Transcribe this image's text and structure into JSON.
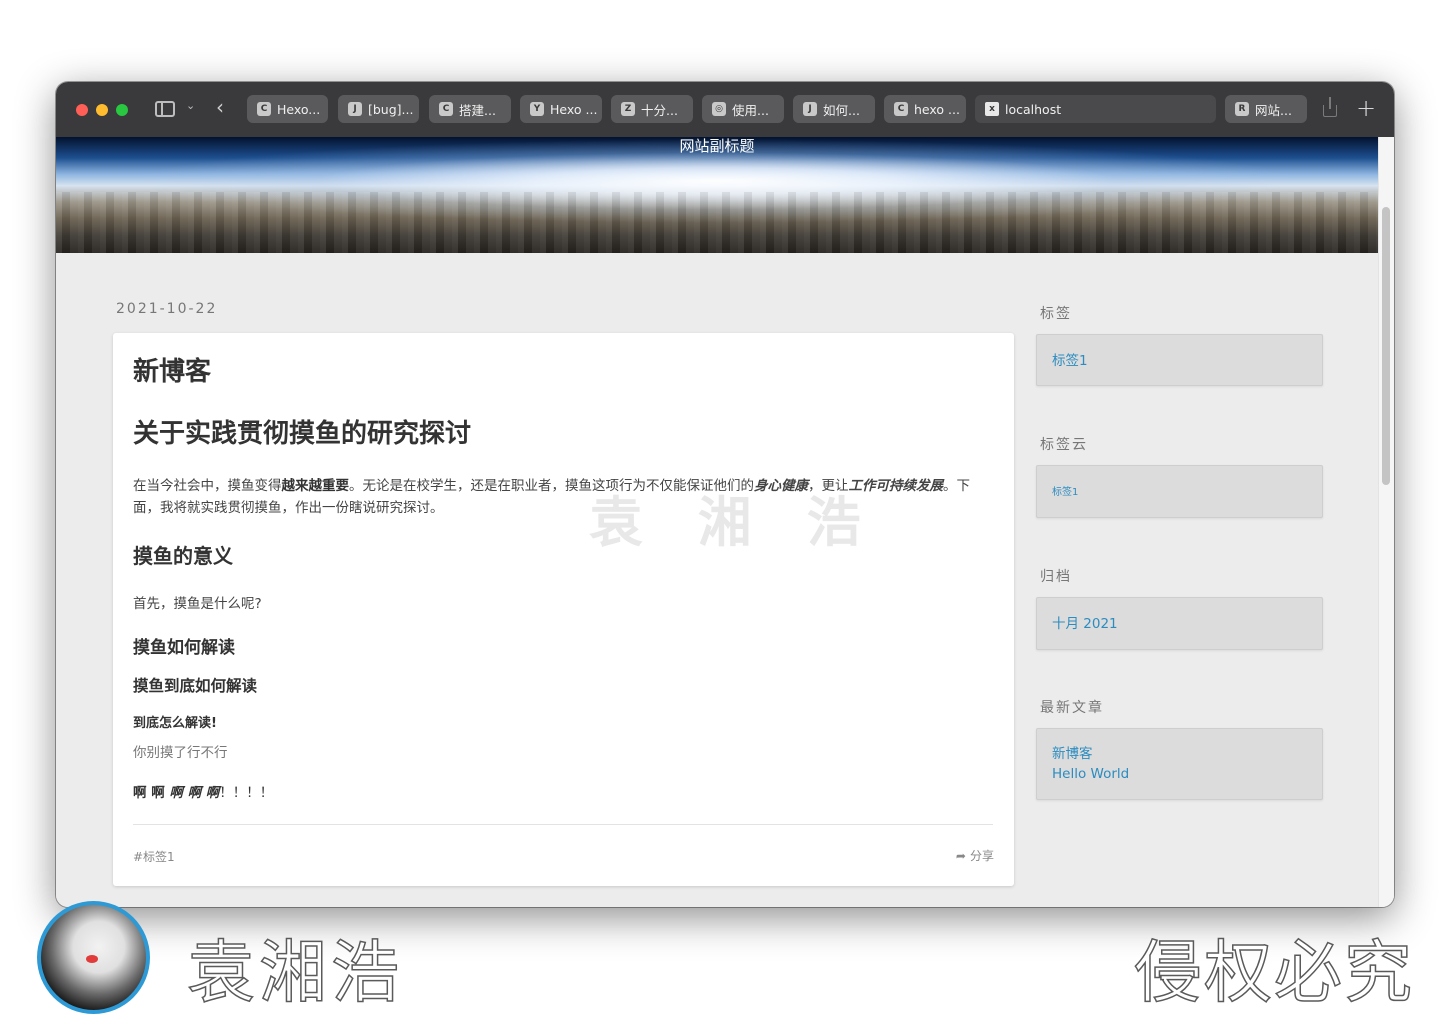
{
  "browser": {
    "tabs": [
      {
        "favicon": "C",
        "label": "Hexo..."
      },
      {
        "favicon": "J",
        "label": "[bug]..."
      },
      {
        "favicon": "C",
        "label": "搭建..."
      },
      {
        "favicon": "Y",
        "label": "Hexo ..."
      },
      {
        "favicon": "Z",
        "label": "十分..."
      },
      {
        "favicon": "◎",
        "label": "使用..."
      },
      {
        "favicon": "J",
        "label": "如何..."
      },
      {
        "favicon": "C",
        "label": "hexo ..."
      },
      {
        "favicon": "x",
        "label": "localhost"
      },
      {
        "favicon": "R",
        "label": "网站..."
      }
    ]
  },
  "site": {
    "subtitle": "网站副标题"
  },
  "post": {
    "date": "2021-10-22",
    "title": "新博客",
    "h1": "关于实践贯彻摸鱼的研究探讨",
    "para_1": "在当今社会中，摸鱼变得",
    "para_bold": "越来越重要",
    "para_2": "。无论是在校学生，还是在职业者，摸鱼这项行为不仅能保证他们的",
    "para_em1": "身心健康",
    "para_3": "，更让",
    "para_em2": "工作可持续发展",
    "para_4": "。下面，我将就实践贯彻摸鱼，作出一份瞎说研究探讨。",
    "h2": "摸鱼的意义",
    "p2": "首先，摸鱼是什么呢?",
    "h3": "摸鱼如何解读",
    "h4": "摸鱼到底如何解读",
    "h5": "到底怎么解读!",
    "h6": "你别摸了行不行",
    "p3_a": "啊 啊 ",
    "p3_b": "啊 啊 啊",
    "p3_c": "！！！！",
    "tag": "#标签1",
    "share": "分享",
    "watermark": "袁 湘 浩"
  },
  "sidebar": {
    "tags_title": "标签",
    "tags_item": "标签1",
    "cloud_title": "标签云",
    "cloud_item": "标签1",
    "archive_title": "归档",
    "archive_item": "十月 2021",
    "recent_title": "最新文章",
    "recent_items": [
      "新博客",
      "Hello World"
    ]
  },
  "overlay": {
    "name": "袁湘浩",
    "notice": "侵权必究"
  }
}
